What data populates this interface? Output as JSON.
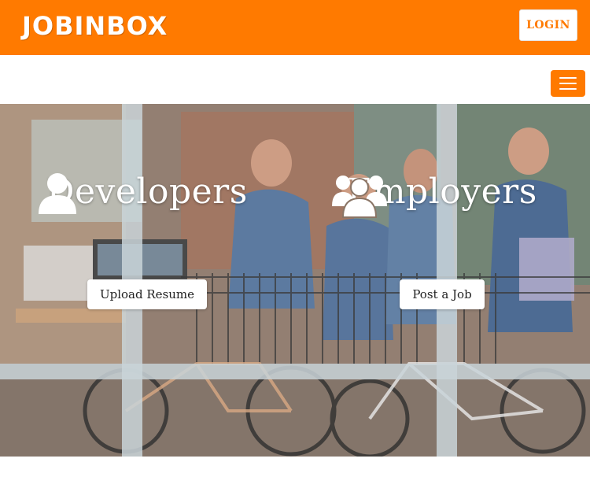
{
  "header": {
    "logo_text": "JOBINBOX",
    "login_label": "LOGIN",
    "menu_icon": "hamburger-menu-icon",
    "accent_color": "#ff7a00"
  },
  "hero": {
    "developers": {
      "title": "Developers",
      "icon": "user-icon",
      "button_label": "Upload Resume"
    },
    "employers": {
      "title": "Employers",
      "icon": "group-icon",
      "button_label": "Post a Job"
    }
  }
}
